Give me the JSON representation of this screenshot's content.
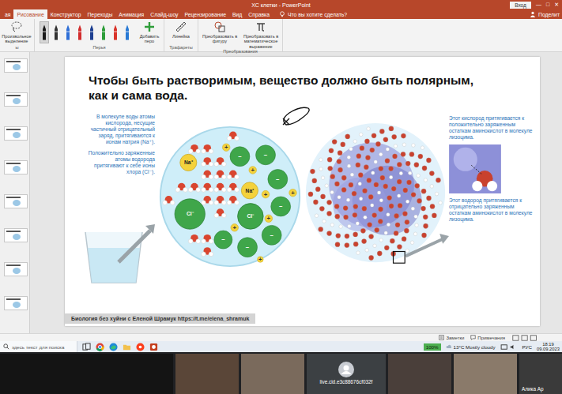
{
  "window": {
    "title": "ХС клетки - PowerPoint",
    "sign_in": "Вход",
    "controls": [
      "—",
      "□",
      "✕"
    ]
  },
  "tabs": [
    {
      "label": "ая",
      "selected": false
    },
    {
      "label": "Рисование",
      "selected": true
    },
    {
      "label": "Конструктор",
      "selected": false
    },
    {
      "label": "Переходы",
      "selected": false
    },
    {
      "label": "Анимация",
      "selected": false
    },
    {
      "label": "Слайд-шоу",
      "selected": false
    },
    {
      "label": "Рецензирование",
      "selected": false
    },
    {
      "label": "Вид",
      "selected": false
    },
    {
      "label": "Справка",
      "selected": false
    }
  ],
  "tell_me": "Что вы хотите сделать?",
  "share": "Поделит",
  "ribbon": {
    "lasso": {
      "group": "ы",
      "label": "Произвольное выделение"
    },
    "pens": {
      "group": "Перья",
      "add": "Добавить перо",
      "items": [
        {
          "color": "#1a1a1a",
          "selected": true
        },
        {
          "color": "#333333",
          "selected": false
        },
        {
          "color": "#2f6fd6",
          "selected": false
        },
        {
          "color": "#d22d2d",
          "selected": false
        },
        {
          "color": "#1d3f91",
          "selected": false
        },
        {
          "color": "#2e9d3a",
          "selected": false
        },
        {
          "color": "#d9342b",
          "selected": false
        },
        {
          "color": "#2a7ad5",
          "selected": false
        }
      ]
    },
    "stencils": {
      "group": "Трафареты",
      "ruler": "Линейка"
    },
    "convert": {
      "group": "Преобразования",
      "items": [
        "Преобразовать в фигуру",
        "Преобразовать в математическое выражение"
      ]
    }
  },
  "thumbnails": [
    {
      "selected": false
    },
    {
      "selected": false
    },
    {
      "selected": false
    },
    {
      "selected": false
    },
    {
      "selected": false
    },
    {
      "selected": false
    },
    {
      "selected": false
    },
    {
      "selected": false
    }
  ],
  "slide": {
    "title_lines": [
      "Чтобы быть растворимым, вещество должно быть полярным,",
      "как и сама вода."
    ],
    "left_figure": {
      "callouts": [
        "В молекуле воды атомы кислорода, несущие частичный отрицательный заряд, притягиваются к ионам натрия (Na⁺).",
        "Положительно заряженные атомы водорода притягивают к себе ионы хлора (Cl⁻)."
      ],
      "ions": [
        {
          "label": "Na⁺",
          "kind": "sodium"
        },
        {
          "label": "Cl⁻",
          "kind": "chloride"
        },
        {
          "label": "Na⁺",
          "kind": "sodium"
        },
        {
          "label": "Cl⁻",
          "kind": "chloride"
        }
      ],
      "lattice_signs": {
        "positive": "+",
        "negative": "−"
      }
    },
    "right_figure": {
      "callouts": [
        "Этот кислород притягивается к положительно заряженным остаткам аминокислот в молекуле лизоцима.",
        "Этот водород притягивается к отрицательно заряженным остаткам аминокислот в молекуле лизоцима."
      ]
    },
    "footer": "Биология без хуйни с Еленой Шрамук https://t.me/elena_shramuk"
  },
  "status_bar": {
    "notes": "Заметки",
    "comments": "Примечания"
  },
  "taskbar": {
    "search": "здесь текст для поиска",
    "zoom": "100%",
    "weather": "13°C Mostly cloudy",
    "language": "РУС",
    "time": "18:19",
    "date": "09.09.2023"
  },
  "call": {
    "tiles": [
      {
        "kind": "video",
        "label": ""
      },
      {
        "kind": "video",
        "label": ""
      },
      {
        "kind": "avatar",
        "label": "live.cid.e3c88676cf032f"
      },
      {
        "kind": "video",
        "label": ""
      },
      {
        "kind": "video",
        "label": ""
      },
      {
        "kind": "video",
        "label": "Алика Ар"
      }
    ]
  }
}
